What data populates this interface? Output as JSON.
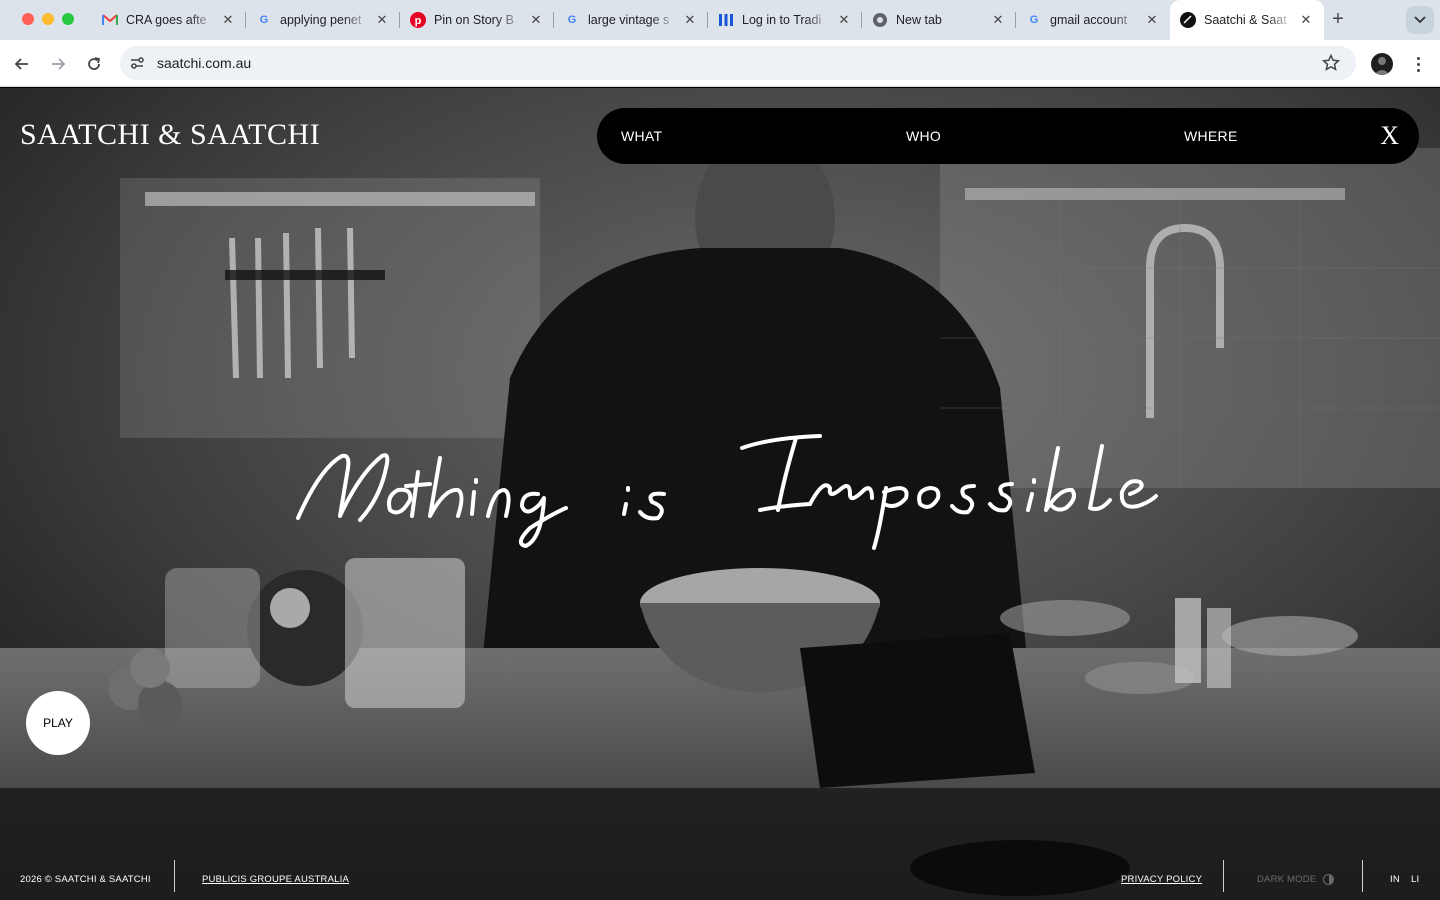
{
  "browser": {
    "tabs": [
      {
        "title": "CRA goes afte",
        "icon": "gmail-icon"
      },
      {
        "title": "applying penet",
        "icon": "google-icon"
      },
      {
        "title": "Pin on Story B",
        "icon": "pinterest-icon"
      },
      {
        "title": "large vintage s",
        "icon": "google-icon"
      },
      {
        "title": "Log in to Tradi",
        "icon": "trading-icon"
      },
      {
        "title": "New tab",
        "icon": "chrome-icon"
      },
      {
        "title": "gmail account",
        "icon": "google-icon"
      },
      {
        "title": "Saatchi & Saat",
        "icon": "saatchi-icon",
        "active": true
      }
    ],
    "url": "saatchi.com.au"
  },
  "site": {
    "logo": "SAATCHI & SAATCHI",
    "nav": {
      "what": "WHAT",
      "who": "WHO",
      "where": "WHERE",
      "close": "X"
    },
    "tagline": "Nothing is Impossible",
    "play": "PLAY",
    "footer": {
      "copyright": "2026 © SAATCHI & SAATCHI",
      "group_link": "PUBLICIS GROUPE AUSTRALIA",
      "privacy": "PRIVACY POLICY",
      "dark_mode": "DARK MODE",
      "instagram": "IN",
      "linkedin": "LI"
    }
  },
  "colors": {
    "accent": "#000000",
    "text": "#ffffff",
    "chrome_bg": "#dde3ea"
  }
}
